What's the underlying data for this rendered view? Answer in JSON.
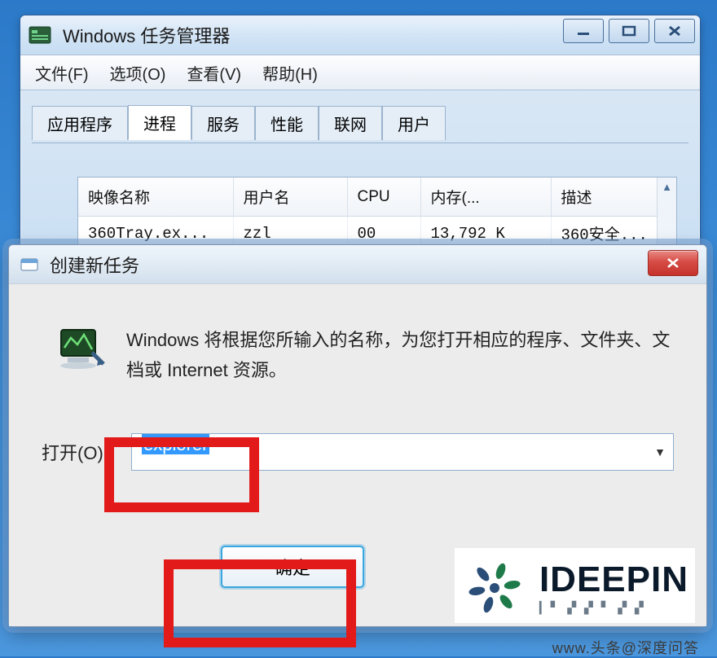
{
  "task_manager": {
    "title": "Windows 任务管理器",
    "menu": {
      "file": "文件(F)",
      "options": "选项(O)",
      "view": "查看(V)",
      "help": "帮助(H)"
    },
    "tabs": {
      "apps": "应用程序",
      "processes": "进程",
      "services": "服务",
      "performance": "性能",
      "network": "联网",
      "users": "用户"
    },
    "columns": {
      "image": "映像名称",
      "user": "用户名",
      "cpu": "CPU",
      "mem": "内存(...",
      "desc": "描述"
    },
    "rows": [
      {
        "image": "360Tray.ex...",
        "user": "zzl",
        "cpu": "00",
        "mem": "13,792 K",
        "desc": "360安全..."
      }
    ]
  },
  "run_dialog": {
    "title": "创建新任务",
    "message": "Windows 将根据您所输入的名称，为您打开相应的程序、文件夹、文档或 Internet 资源。",
    "open_label": "打开(O):",
    "open_value": "explorer",
    "ok_label": "确定"
  },
  "branding": {
    "logo_text": "IDEEPIN",
    "logo_sub": "▎▘ ▞ ▞ ▘ ▞ ▞",
    "url": "www.头条@深度问答"
  }
}
